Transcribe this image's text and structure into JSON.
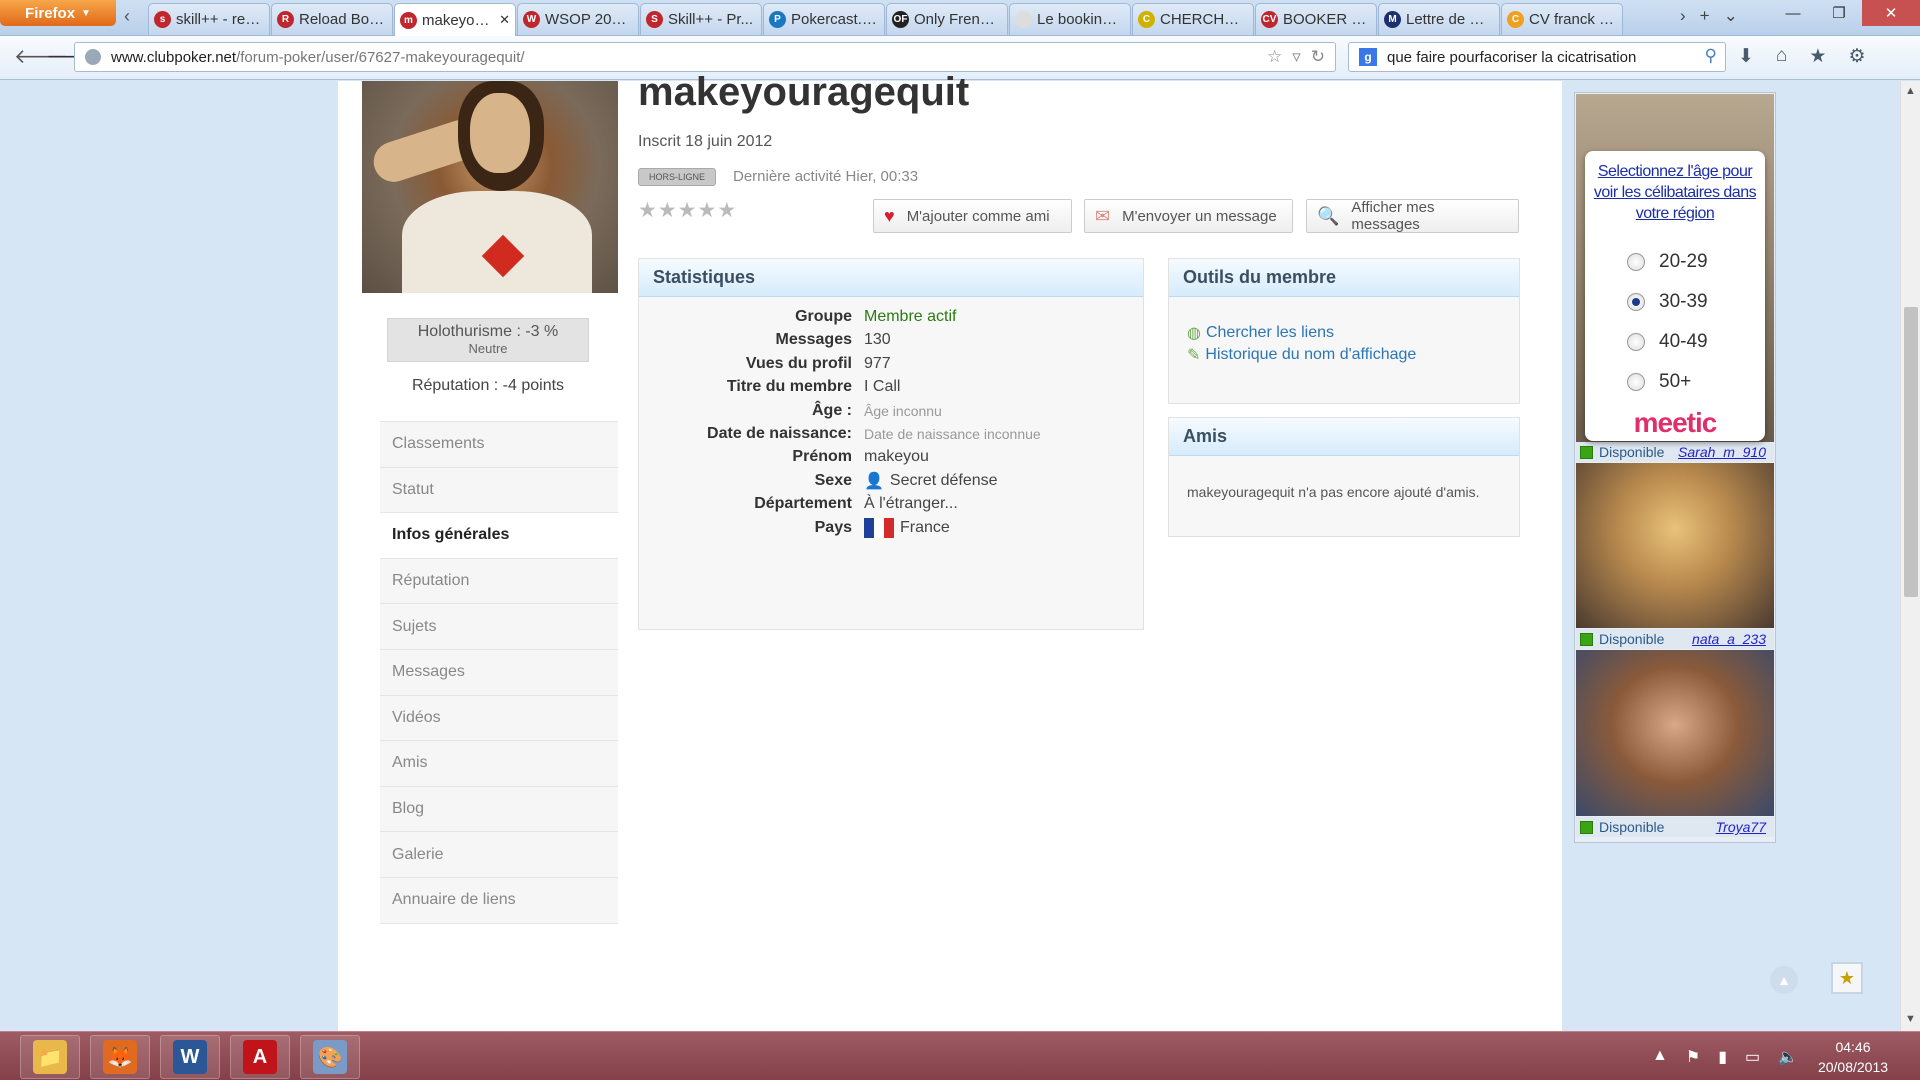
{
  "browser": {
    "menu_label": "Firefox",
    "tabs": [
      {
        "label": "skill++ - rec...",
        "icon": "poker-chip-icon",
        "color": "#c0262d",
        "glyph": "s"
      },
      {
        "label": "Reload Bon...",
        "icon": "pokerstrategy-icon",
        "color": "#c0262d",
        "glyph": "R"
      },
      {
        "label": "makeyou...",
        "icon": "poker-chip-icon",
        "color": "#c0262d",
        "glyph": "m",
        "active": true
      },
      {
        "label": "WSOP 2013 ...",
        "icon": "poker-chip-icon",
        "color": "#c0262d",
        "glyph": "W"
      },
      {
        "label": "Skill++ - Pr...",
        "icon": "poker-chip-icon",
        "color": "#c0262d",
        "glyph": "S"
      },
      {
        "label": "Pokercast.tv...",
        "icon": "pokercast-icon",
        "color": "#1a78c2",
        "glyph": "P"
      },
      {
        "label": "Only French ...",
        "icon": "onlyfrench-icon",
        "color": "#222222",
        "glyph": "OF"
      },
      {
        "label": "Le booking, ...",
        "icon": "blank-page-icon",
        "color": "#dddddd",
        "glyph": ""
      },
      {
        "label": "CHERCHE B...",
        "icon": "leaf-icon",
        "color": "#d2b000",
        "glyph": "C"
      },
      {
        "label": "BOOKER (M...",
        "icon": "cv-icon",
        "color": "#c0262d",
        "glyph": "CV"
      },
      {
        "label": "Lettre de m...",
        "icon": "m-logo-icon",
        "color": "#1d2f6f",
        "glyph": "M"
      },
      {
        "label": "CV franck ro...",
        "icon": "folder-icon",
        "color": "#f0a020",
        "glyph": "C"
      }
    ],
    "url_domain": "www.clubpoker.net",
    "url_path": "/forum-poker/user/67627-makeyouragequit/",
    "search_engine": "g",
    "search_query": "que faire pourfacoriser la cicatrisation"
  },
  "profile": {
    "username": "makeyouragequit",
    "joined": "Inscrit 18 juin 2012",
    "status_badge": "HORS-LIGNE",
    "last_activity": "Dernière activité Hier, 00:33",
    "rating": 0,
    "rating_max": 5,
    "reputation_line1": "Holothurisme : -3 %",
    "reputation_line2": "Neutre",
    "reputation_points": "Réputation : -4 points",
    "actions": {
      "add_friend": "M'ajouter comme ami",
      "send_message": "M'envoyer un message",
      "show_messages": "Afficher mes messages"
    }
  },
  "sidebar": {
    "items": [
      {
        "label": "Classements"
      },
      {
        "label": "Statut"
      },
      {
        "label": "Infos générales",
        "active": true
      },
      {
        "label": "Réputation"
      },
      {
        "label": "Sujets"
      },
      {
        "label": "Messages"
      },
      {
        "label": "Vidéos"
      },
      {
        "label": "Amis"
      },
      {
        "label": "Blog"
      },
      {
        "label": "Galerie"
      },
      {
        "label": "Annuaire de liens"
      }
    ]
  },
  "stats": {
    "title": "Statistiques",
    "rows": [
      {
        "label": "Groupe",
        "value": "Membre actif",
        "style": "green"
      },
      {
        "label": "Messages",
        "value": "130"
      },
      {
        "label": "Vues du profil",
        "value": "977"
      },
      {
        "label": "Titre du membre",
        "value": "I Call"
      },
      {
        "label": "Âge :",
        "value": "Âge inconnu",
        "style": "muted"
      },
      {
        "label": "Date de naissance:",
        "value": "Date de naissance inconnue",
        "style": "muted"
      },
      {
        "label": "Prénom",
        "value": "makeyou"
      },
      {
        "label": "Sexe",
        "value": "Secret défense",
        "icon": "user-silhouette-icon"
      },
      {
        "label": "Département",
        "value": "À l'étranger..."
      },
      {
        "label": "Pays",
        "value": "France",
        "icon": "france-flag-icon"
      }
    ]
  },
  "tools": {
    "title": "Outils du membre",
    "links": [
      {
        "label": "Chercher les liens",
        "icon": "globe-icon"
      },
      {
        "label": "Historique du nom d'affichage",
        "icon": "pencil-icon"
      }
    ]
  },
  "friends": {
    "title": "Amis",
    "empty_text": "makeyouragequit n'a pas encore ajouté d'amis."
  },
  "ad": {
    "prompt": "Selectionnez l'âge pour voir les célibataires dans votre région",
    "age_options": [
      {
        "label": "20-29",
        "selected": false
      },
      {
        "label": "30-39",
        "selected": true
      },
      {
        "label": "40-49",
        "selected": false
      },
      {
        "label": "50+",
        "selected": false
      }
    ],
    "brand": "meetic",
    "profiles": [
      {
        "status": "Disponible",
        "name": "Sarah_m_910"
      },
      {
        "status": "Disponible",
        "name": "nata_a_233"
      },
      {
        "status": "Disponible",
        "name": "Troya77"
      }
    ]
  },
  "taskbar": {
    "apps": [
      {
        "name": "explorer-icon",
        "glyph": "📁",
        "color": "#e8b84a"
      },
      {
        "name": "firefox-icon",
        "glyph": "🦊",
        "color": "#e06a20"
      },
      {
        "name": "word-icon",
        "glyph": "W",
        "color": "#2b5797"
      },
      {
        "name": "acrobat-icon",
        "glyph": "A",
        "color": "#c0131a"
      },
      {
        "name": "paint-icon",
        "glyph": "🎨",
        "color": "#7a9ac8"
      }
    ],
    "time": "04:46",
    "date": "20/08/2013"
  }
}
